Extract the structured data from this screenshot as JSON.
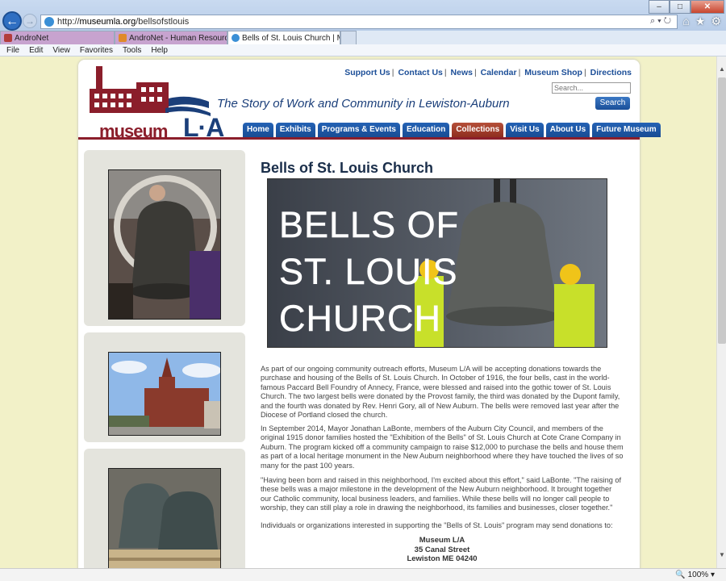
{
  "browser": {
    "url_prefix": "http://",
    "url_host": "museumla.org",
    "url_path": "/bellsofstlouis",
    "tabs": [
      {
        "label": "AndroNet"
      },
      {
        "label": "AndroNet - Human Resources:..."
      },
      {
        "label": "Bells of St. Louis Church | M...",
        "close": "×"
      }
    ],
    "menu": [
      "File",
      "Edit",
      "View",
      "Favorites",
      "Tools",
      "Help"
    ],
    "zoom": "100%"
  },
  "site": {
    "logo_word": "museum",
    "logo_la": "L·A",
    "tagline": "The Story of Work and Community in Lewiston-Auburn",
    "top_links": [
      "Support Us",
      "Contact Us",
      "News",
      "Calendar",
      "Museum Shop",
      "Directions"
    ],
    "search_placeholder": "Search...",
    "search_button": "Search",
    "nav": [
      "Home",
      "Exhibits",
      "Programs & Events",
      "Education",
      "Collections",
      "Visit Us",
      "About Us",
      "Future Museum"
    ],
    "active_nav": "Collections"
  },
  "main": {
    "title": "Bells of St. Louis Church",
    "hero_lines": [
      "BELLS OF",
      "ST. LOUIS",
      "CHURCH"
    ],
    "paragraphs": [
      "As part of our ongoing community outreach efforts, Museum L/A will be accepting donations towards the purchase and housing of the Bells of St. Louis Church. In October of 1916, the four bells, cast in the world-famous Paccard Bell Foundry of Annecy, France, were blessed and raised into the gothic tower of St. Louis Church. The two largest bells were donated by the Provost family, the third was donated by the Dupont family, and the fourth was donated by Rev. Henri Gory, all of New Auburn. The bells were removed last year after the Diocese of Portland closed the church.",
      "In September 2014, Mayor Jonathan LaBonte, members of the Auburn City Council, and members of the original 1915 donor families hosted the \"Exhibition of the Bells\" of St. Louis Church at Cote Crane Company in Auburn. The program kicked off a community campaign to raise $12,000 to purchase the bells and house them as part of a local heritage monument in the New Auburn neighborhood where they have touched the lives of so many for the past 100 years.",
      "\"Having been born and raised in this neighborhood, I'm excited about this effort,\" said LaBonte. \"The raising of these bells was a major milestone in the development of the New Auburn neighborhood. It brought together our Catholic community, local business leaders, and families. While these bells will no longer call people to worship, they can still play a role in drawing the neighborhood, its families and businesses, closer together.\"",
      "Individuals or organizations interested in supporting the \"Bells of St. Louis\" program may send donations to:"
    ],
    "address": [
      "Museum L/A",
      "35 Canal Street",
      "Lewiston ME 04240"
    ]
  }
}
